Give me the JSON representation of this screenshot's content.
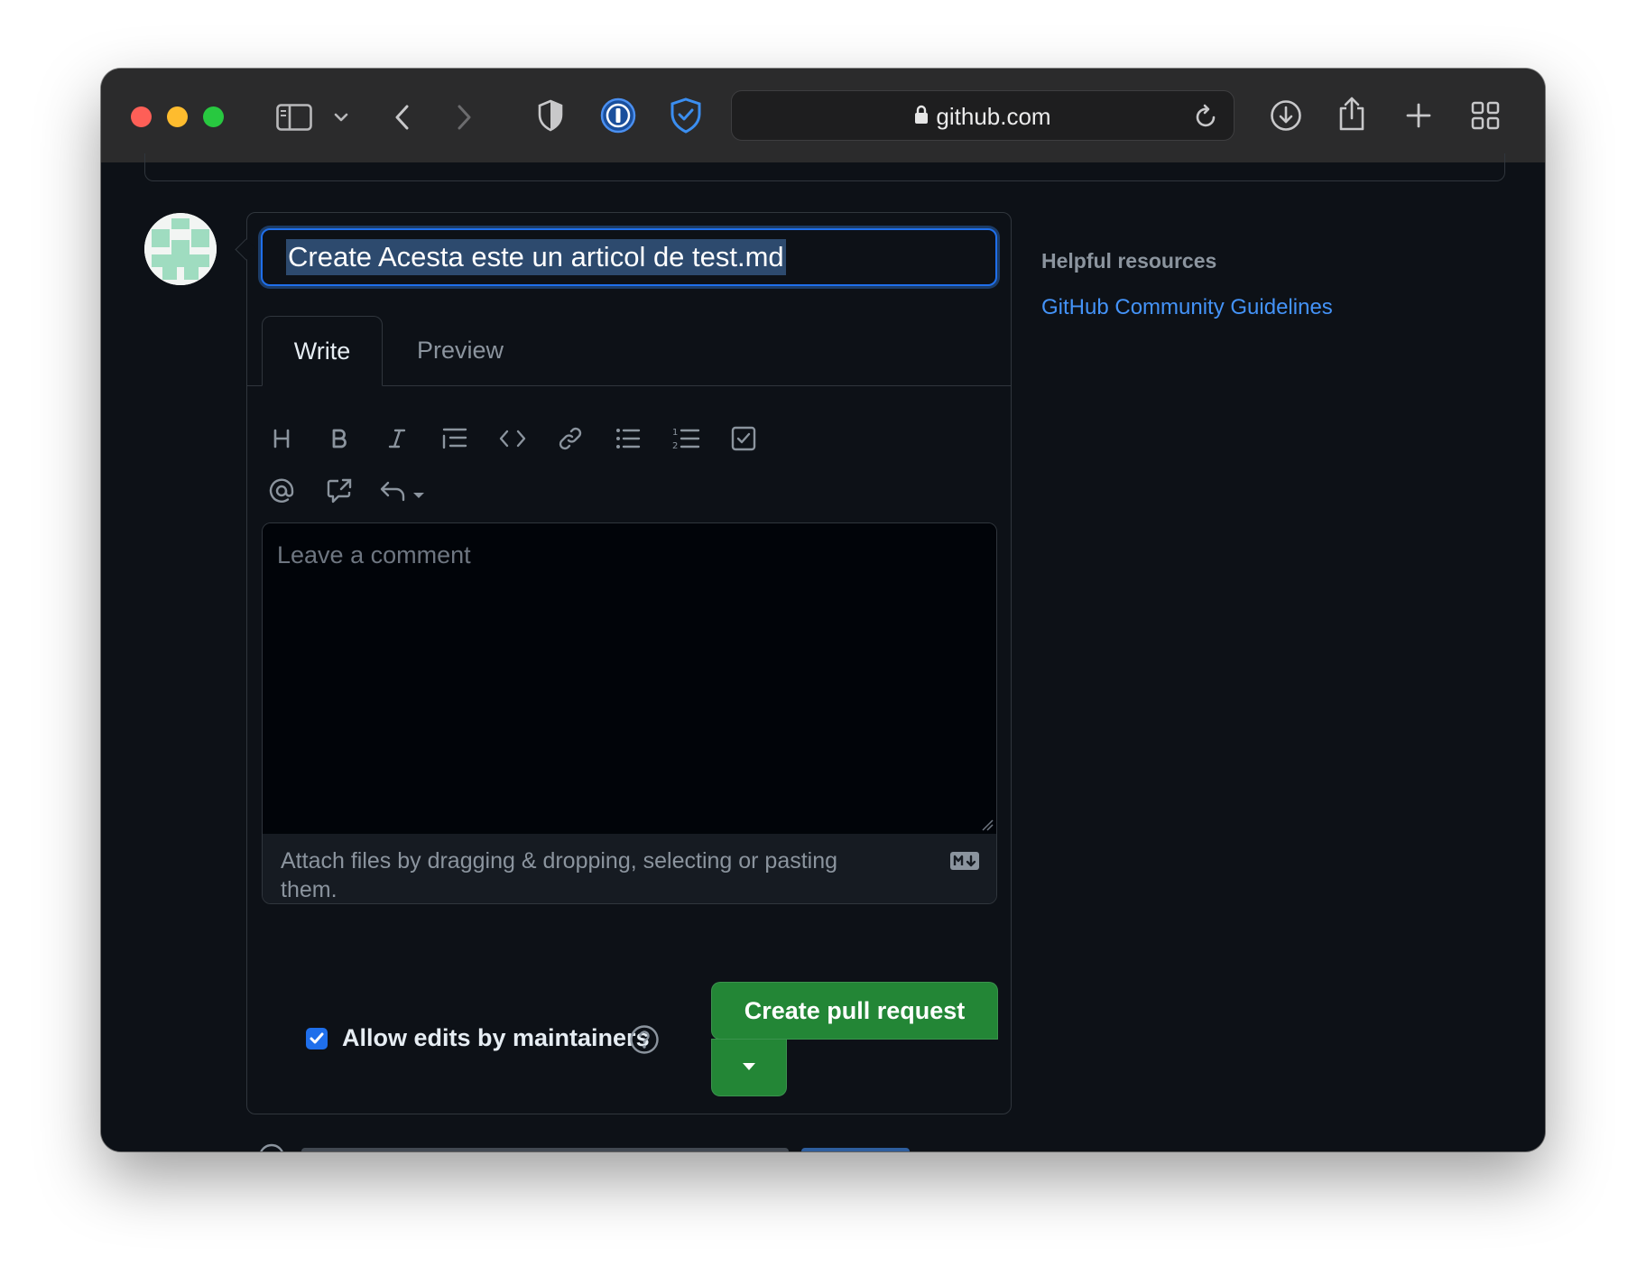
{
  "browser": {
    "url": "github.com",
    "window_controls": [
      "close",
      "minimize",
      "zoom"
    ],
    "toolbar_icons": [
      "sidebar-icon",
      "chevron-down-icon",
      "back-icon",
      "forward-icon",
      "privacy-shield-icon",
      "onepassword-icon",
      "security-shield-icon",
      "lock-icon",
      "reload-icon",
      "download-icon",
      "share-icon",
      "plus-icon",
      "tabs-grid-icon"
    ]
  },
  "form": {
    "title_value": "Create Acesta este un articol de test.md",
    "tabs": [
      {
        "label": "Write",
        "selected": true
      },
      {
        "label": "Preview",
        "selected": false
      }
    ],
    "toolbar": [
      "heading-icon",
      "bold-icon",
      "italic-icon",
      "quote-icon",
      "code-icon",
      "link-icon",
      "bulleted-list-icon",
      "numbered-list-icon",
      "task-list-icon",
      "mention-icon",
      "reference-icon",
      "saved-replies-icon"
    ],
    "comment_placeholder": "Leave a comment",
    "attach_text": "Attach files by dragging & dropping, selecting or pasting them.",
    "allow_edits_label": "Allow edits by maintainers",
    "allow_edits_checked": true,
    "submit_label": "Create pull request"
  },
  "sidebar": {
    "heading": "Helpful resources",
    "link": "GitHub Community Guidelines"
  },
  "colors": {
    "page_bg": "#0d1117",
    "accent_blue": "#1f6feb",
    "button_green": "#238636",
    "link_blue": "#4493f8"
  }
}
